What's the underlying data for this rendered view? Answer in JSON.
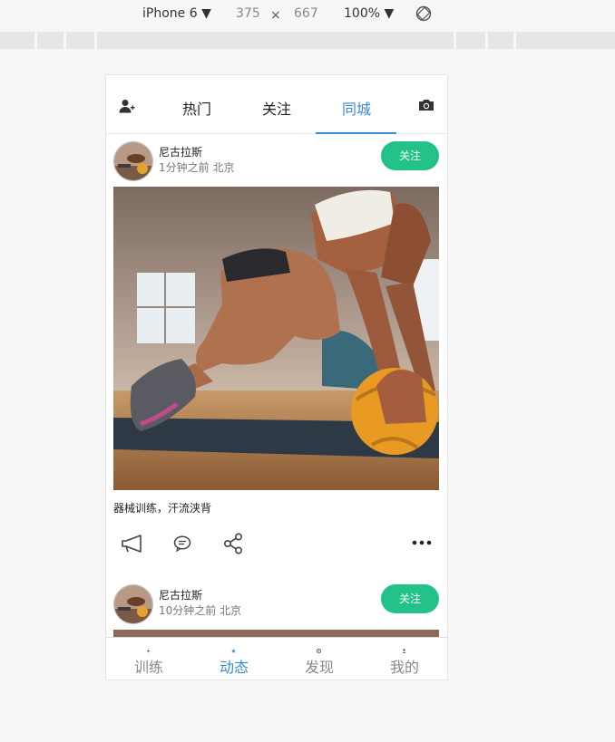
{
  "devtools": {
    "device": "iPhone 6",
    "width": "375",
    "times": "×",
    "height": "667",
    "zoom": "100%"
  },
  "top_nav": {
    "tabs": [
      {
        "label": "热门"
      },
      {
        "label": "关注"
      },
      {
        "label": "同城",
        "active": true
      }
    ],
    "left_icon": "add-user-icon",
    "right_icon": "camera-icon"
  },
  "posts": [
    {
      "username": "尼古拉斯",
      "time_location": "1分钟之前 北京",
      "follow_label": "关注",
      "caption": "器械训练，汗流浃背"
    },
    {
      "username": "尼古拉斯",
      "time_location": "10分钟之前 北京",
      "follow_label": "关注"
    }
  ],
  "actions": {
    "icons": [
      "megaphone-icon",
      "comment-icon",
      "share-icon",
      "more-icon"
    ]
  },
  "tab_bar": {
    "items": [
      {
        "label": "训练"
      },
      {
        "label": "动态",
        "active": true
      },
      {
        "label": "发现"
      },
      {
        "label": "我的"
      }
    ]
  },
  "colors": {
    "accent": "#3b8bd1",
    "follow_button": "#22c288"
  }
}
